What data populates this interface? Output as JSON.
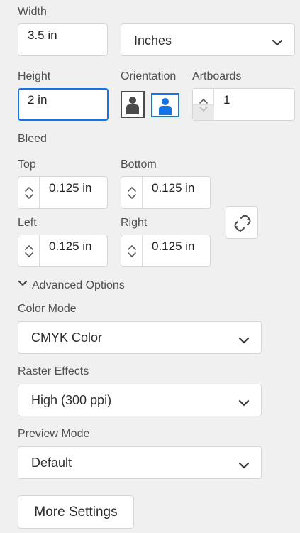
{
  "width": {
    "label": "Width",
    "value": "3.5 in",
    "units_select": "Inches"
  },
  "height": {
    "label": "Height",
    "value": "2 in"
  },
  "orientation": {
    "label": "Orientation",
    "selected": "landscape"
  },
  "artboards": {
    "label": "Artboards",
    "value": "1"
  },
  "bleed": {
    "label": "Bleed",
    "top_label": "Top",
    "top_value": "0.125 in",
    "bottom_label": "Bottom",
    "bottom_value": "0.125 in",
    "left_label": "Left",
    "left_value": "0.125 in",
    "right_label": "Right",
    "right_value": "0.125 in"
  },
  "advanced": {
    "toggle_label": "Advanced Options",
    "color_mode_label": "Color Mode",
    "color_mode_value": "CMYK Color",
    "raster_label": "Raster Effects",
    "raster_value": "High (300 ppi)",
    "preview_label": "Preview Mode",
    "preview_value": "Default"
  },
  "more_settings_label": "More Settings",
  "colors": {
    "accent": "#1473e6",
    "background": "#f0f0f0"
  }
}
